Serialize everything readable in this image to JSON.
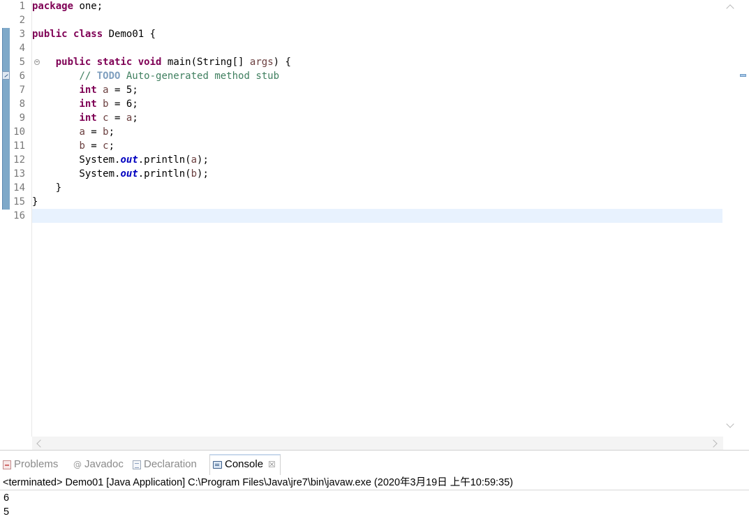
{
  "editor": {
    "line_numbers": [
      "1",
      "2",
      "3",
      "4",
      "5",
      "6",
      "7",
      "8",
      "9",
      "10",
      "11",
      "12",
      "13",
      "14",
      "15",
      "16"
    ],
    "lines": [
      [
        {
          "t": "package",
          "c": "kw"
        },
        {
          "t": " one;",
          "c": ""
        }
      ],
      [],
      [
        {
          "t": "public",
          "c": "kw"
        },
        {
          "t": " ",
          "c": ""
        },
        {
          "t": "class",
          "c": "kw"
        },
        {
          "t": " Demo01 {",
          "c": ""
        }
      ],
      [],
      [
        {
          "t": "    ",
          "c": ""
        },
        {
          "t": "public",
          "c": "kw"
        },
        {
          "t": " ",
          "c": ""
        },
        {
          "t": "static",
          "c": "kw"
        },
        {
          "t": " ",
          "c": ""
        },
        {
          "t": "void",
          "c": "kw"
        },
        {
          "t": " main(String[] ",
          "c": ""
        },
        {
          "t": "args",
          "c": "var"
        },
        {
          "t": ") {",
          "c": ""
        }
      ],
      [
        {
          "t": "        ",
          "c": ""
        },
        {
          "t": "// ",
          "c": "cm"
        },
        {
          "t": "TODO",
          "c": "todo"
        },
        {
          "t": " Auto-generated method stub",
          "c": "cm"
        }
      ],
      [
        {
          "t": "        ",
          "c": ""
        },
        {
          "t": "int",
          "c": "kw"
        },
        {
          "t": " ",
          "c": ""
        },
        {
          "t": "a",
          "c": "var"
        },
        {
          "t": " = 5;",
          "c": ""
        }
      ],
      [
        {
          "t": "        ",
          "c": ""
        },
        {
          "t": "int",
          "c": "kw"
        },
        {
          "t": " ",
          "c": ""
        },
        {
          "t": "b",
          "c": "var"
        },
        {
          "t": " = 6;",
          "c": ""
        }
      ],
      [
        {
          "t": "        ",
          "c": ""
        },
        {
          "t": "int",
          "c": "kw"
        },
        {
          "t": " ",
          "c": ""
        },
        {
          "t": "c",
          "c": "var"
        },
        {
          "t": " = ",
          "c": ""
        },
        {
          "t": "a",
          "c": "var"
        },
        {
          "t": ";",
          "c": ""
        }
      ],
      [
        {
          "t": "        ",
          "c": ""
        },
        {
          "t": "a",
          "c": "var"
        },
        {
          "t": " = ",
          "c": ""
        },
        {
          "t": "b",
          "c": "var"
        },
        {
          "t": ";",
          "c": ""
        }
      ],
      [
        {
          "t": "        ",
          "c": ""
        },
        {
          "t": "b",
          "c": "var"
        },
        {
          "t": " = ",
          "c": ""
        },
        {
          "t": "c",
          "c": "var"
        },
        {
          "t": ";",
          "c": ""
        }
      ],
      [
        {
          "t": "        System.",
          "c": ""
        },
        {
          "t": "out",
          "c": "fld"
        },
        {
          "t": ".println(",
          "c": ""
        },
        {
          "t": "a",
          "c": "var"
        },
        {
          "t": ");",
          "c": ""
        }
      ],
      [
        {
          "t": "        System.",
          "c": ""
        },
        {
          "t": "out",
          "c": "fld"
        },
        {
          "t": ".println(",
          "c": ""
        },
        {
          "t": "b",
          "c": "var"
        },
        {
          "t": ");",
          "c": ""
        }
      ],
      [
        {
          "t": "    }",
          "c": ""
        }
      ],
      [
        {
          "t": "}",
          "c": ""
        }
      ],
      []
    ],
    "current_line": 16,
    "colors": {
      "keyword": "#7f0055",
      "comment": "#3f7f5f",
      "todo": "#7f9fbf",
      "variable": "#6a3e3e",
      "static_field": "#0000c0",
      "current_line_bg": "#e8f2fe"
    }
  },
  "panel": {
    "tabs": [
      {
        "label": "Problems",
        "icon": "problems-icon",
        "active": false
      },
      {
        "label": "Javadoc",
        "icon": "javadoc-icon",
        "active": false
      },
      {
        "label": "Declaration",
        "icon": "declaration-icon",
        "active": false
      },
      {
        "label": "Console",
        "icon": "console-icon",
        "active": true
      }
    ],
    "close_glyph": "☒",
    "javadoc_glyph": "@",
    "console": {
      "header": "<terminated> Demo01 [Java Application] C:\\Program Files\\Java\\jre7\\bin\\javaw.exe (2020年3月19日 上午10:59:35)",
      "output": [
        "6",
        "5"
      ]
    }
  }
}
